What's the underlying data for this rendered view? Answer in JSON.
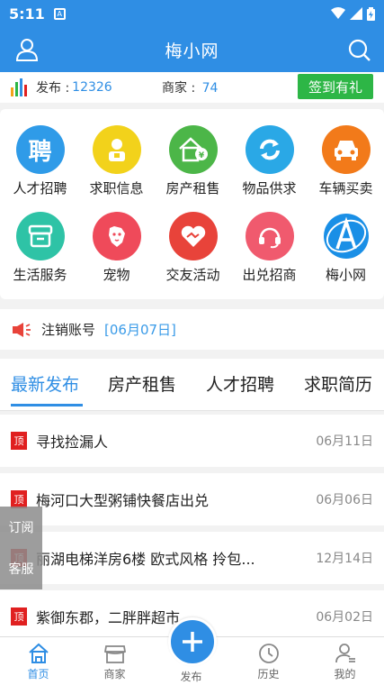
{
  "status_bar": {
    "time": "5:11",
    "notif_glyph": "A"
  },
  "app_bar": {
    "title": "梅小网"
  },
  "stats": {
    "publish_label": "发布 :",
    "publish_count": "12326",
    "merchant_label": "商家 :",
    "merchant_count": "74",
    "checkin_label": "签到有礼"
  },
  "categories": [
    {
      "label": "人才招聘",
      "glyph": "聘",
      "color": "#2f9be8"
    },
    {
      "label": "求职信息",
      "glyph": "",
      "color": "#f2d21b"
    },
    {
      "label": "房产租售",
      "glyph": "",
      "color": "#4cb648"
    },
    {
      "label": "物品供求",
      "glyph": "",
      "color": "#2aa8e6"
    },
    {
      "label": "车辆买卖",
      "glyph": "",
      "color": "#f27a1a"
    },
    {
      "label": "生活服务",
      "glyph": "",
      "color": "#2ec3a6"
    },
    {
      "label": "宠物",
      "glyph": "",
      "color": "#ef4a5a"
    },
    {
      "label": "交友活动",
      "glyph": "",
      "color": "#e8433a"
    },
    {
      "label": "出兑招商",
      "glyph": "",
      "color": "#f05a6e"
    },
    {
      "label": "梅小网",
      "glyph": "",
      "color": "#1a8fe6"
    }
  ],
  "notice": {
    "text": "注销账号",
    "date": "[06月07日]"
  },
  "tabs": [
    "最新发布",
    "房产租售",
    "人才招聘",
    "求职简历"
  ],
  "posts": [
    {
      "badge": "顶",
      "title": "寻找捡漏人",
      "date": "06月11日"
    },
    {
      "badge": "顶",
      "title": "梅河口大型粥铺快餐店出兑",
      "date": "06月06日"
    },
    {
      "badge": "顶",
      "title": "丽湖电梯洋房6楼 欧式风格 拎包...",
      "date": "12月14日"
    },
    {
      "badge": "顶",
      "title": "紫御东郡，二胖胖超市",
      "date": "06月02日"
    }
  ],
  "float_panel": {
    "subscribe": "订阅",
    "service": "客服"
  },
  "bottom_nav": {
    "home": "首页",
    "merchant": "商家",
    "publish": "发布",
    "history": "历史",
    "mine": "我的"
  },
  "colors": {
    "primary": "#2f8ee4",
    "green": "#2db646",
    "red_badge": "#e02020"
  }
}
